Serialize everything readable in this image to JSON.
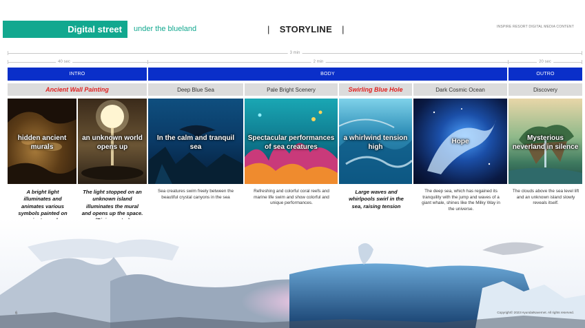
{
  "header": {
    "title": "Digital street",
    "subtitle": "under the blueland",
    "storyline": "STORYLINE",
    "corp": "INSPIRE RESORT DIGITAL MEDIA CONTENT"
  },
  "timeline": {
    "total": "3 min",
    "intro": "40 sec",
    "body": "2 min",
    "outro": "20 sec"
  },
  "phases": {
    "intro": "INTRO",
    "body": "BODY",
    "outro": "OUTRO"
  },
  "sections": [
    {
      "title": "Ancient Wall Painting",
      "highlight": true
    },
    {
      "title": "Deep Blue Sea",
      "highlight": false
    },
    {
      "title": "Pale Bright Scenery",
      "highlight": false
    },
    {
      "title": "Swirling Blue Hole",
      "highlight": true
    },
    {
      "title": "Dark Cosmic Ocean",
      "highlight": false
    },
    {
      "title": "Discovery",
      "highlight": false
    }
  ],
  "panels": [
    {
      "caption": "hidden ancient murals"
    },
    {
      "caption": "an unknown world opens up"
    },
    {
      "caption": "In the calm and tranquil sea"
    },
    {
      "caption": "Spectacular performances of sea creatures"
    },
    {
      "caption": "a whirlwind tension high"
    },
    {
      "caption": "Hope"
    },
    {
      "caption": "Mysterious neverland in silence"
    }
  ],
  "descriptions": [
    {
      "text": "A bright light illuminates and animates various symbols painted on ancient murals.",
      "bold": true
    },
    {
      "text": "The light stopped on an unknown island illuminates the mural and opens up the space. (Rising water)",
      "bold": true
    },
    {
      "text": "Sea creatures swim freely between the beautiful crystal canyons in the sea",
      "bold": false
    },
    {
      "text": "Refreshing and colorful coral reefs and marine life swim and show colorful and unique performances.",
      "bold": false
    },
    {
      "text": "Large waves and whirlpools swirl in the sea, raising tension",
      "bold": true
    },
    {
      "text": "The deep sea, which has regained its tranquility with the jump and waves of a giant whale, shines like the Milky Way in the universe.",
      "bold": false
    },
    {
      "text": "The clouds above the sea level lift and an unknown island slowly reveals itself.",
      "bold": false
    }
  ],
  "footer": {
    "page": "6",
    "copyright": "Copyright© 2023 HyundaiNavernet. All rights reserved."
  }
}
